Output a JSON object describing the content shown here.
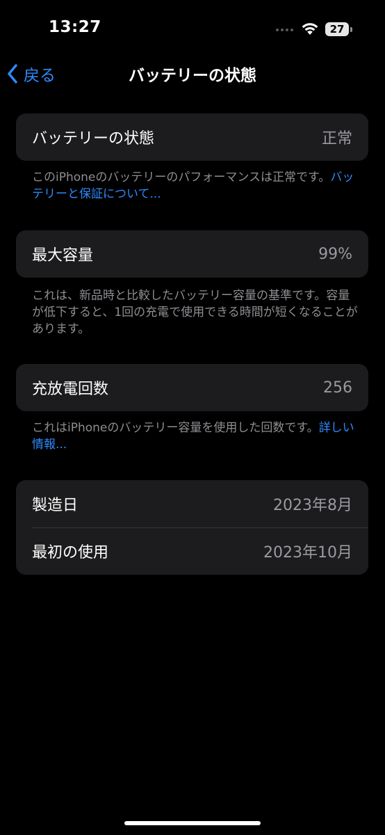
{
  "status_bar": {
    "time": "13:27",
    "battery_level": "27"
  },
  "nav": {
    "back_label": "戻る",
    "title": "バッテリーの状態"
  },
  "battery_health": {
    "label": "バッテリーの状態",
    "value": "正常",
    "note_text": "このiPhoneのバッテリーのパフォーマンスは正常です。",
    "note_link": "バッテリーと保証について..."
  },
  "max_capacity": {
    "label": "最大容量",
    "value": "99%",
    "note_text": "これは、新品時と比較したバッテリー容量の基準です。容量が低下すると、1回の充電で使用できる時間が短くなることがあります。"
  },
  "cycle_count": {
    "label": "充放電回数",
    "value": "256",
    "note_text": "これはiPhoneのバッテリー容量を使用した回数です。",
    "note_link": "詳しい情報..."
  },
  "dates": {
    "manufacture_label": "製造日",
    "manufacture_value": "2023年8月",
    "first_use_label": "最初の使用",
    "first_use_value": "2023年10月"
  },
  "colors": {
    "background": "#000000",
    "card": "#1c1c1e",
    "accent": "#2f8bff",
    "secondary_text": "#8e8e93"
  }
}
